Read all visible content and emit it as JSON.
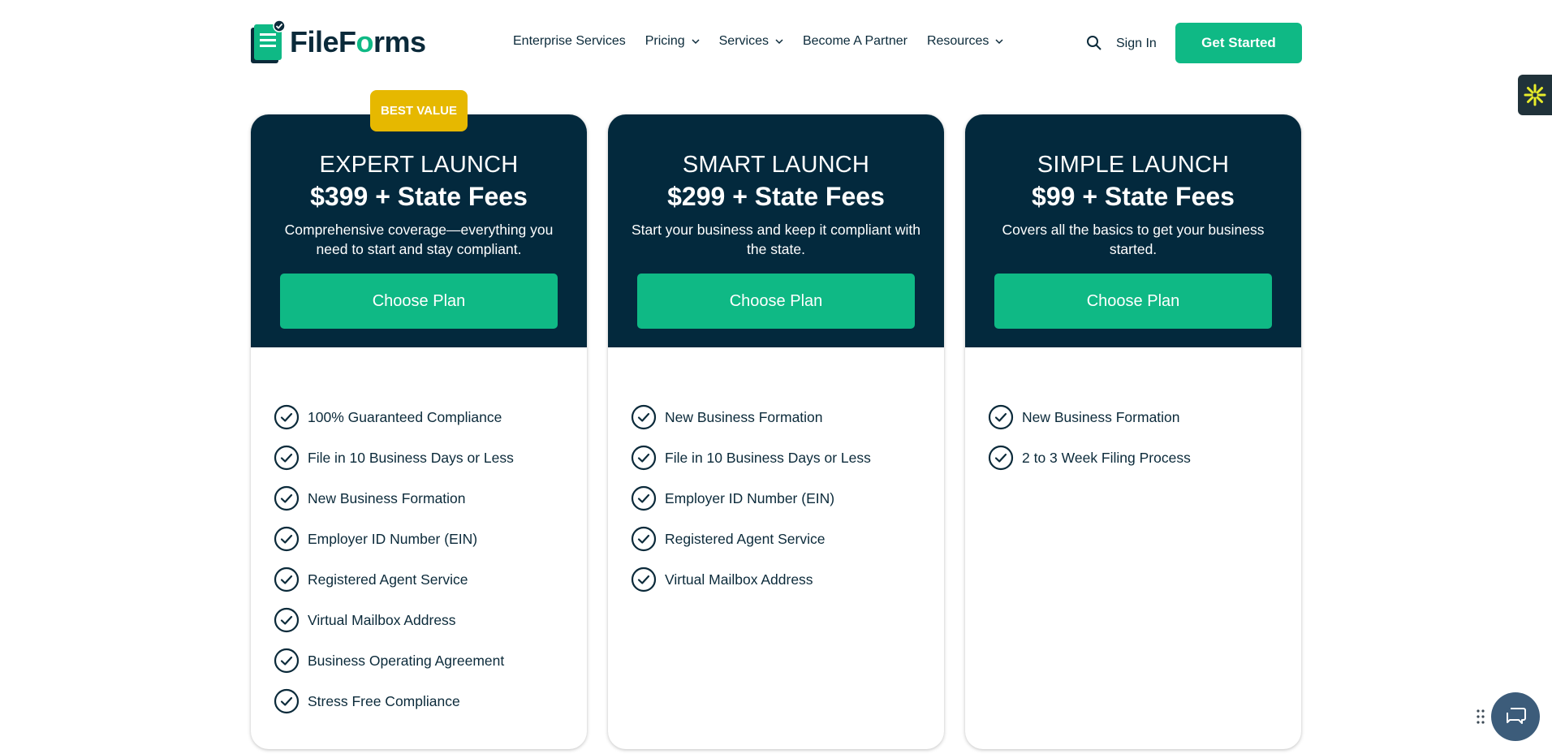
{
  "header": {
    "logo_text_a": "FileF",
    "logo_text_o": "o",
    "logo_text_b": "rms",
    "nav": [
      {
        "label": "Enterprise Services",
        "dropdown": false
      },
      {
        "label": "Pricing",
        "dropdown": true
      },
      {
        "label": "Services",
        "dropdown": true
      },
      {
        "label": "Become A Partner",
        "dropdown": false
      },
      {
        "label": "Resources",
        "dropdown": true
      }
    ],
    "sign_in": "Sign In",
    "get_started": "Get Started"
  },
  "badge": "BEST VALUE",
  "plans": [
    {
      "name": "EXPERT LAUNCH",
      "price": "$399 + State Fees",
      "description": "Comprehensive coverage—everything you need to start and stay compliant.",
      "cta": "Choose Plan",
      "features": [
        "100% Guaranteed Compliance",
        "File in 10 Business Days or Less",
        "New Business Formation",
        "Employer ID Number (EIN)",
        "Registered Agent Service",
        "Virtual Mailbox Address",
        "Business Operating Agreement",
        "Stress Free Compliance"
      ]
    },
    {
      "name": "SMART LAUNCH",
      "price": "$299 + State Fees",
      "description": "Start your business and keep it compliant with the state.",
      "cta": "Choose Plan",
      "features": [
        "New Business Formation",
        "File in 10 Business Days or Less",
        "Employer ID Number (EIN)",
        "Registered Agent Service",
        "Virtual Mailbox Address"
      ]
    },
    {
      "name": "SIMPLE LAUNCH",
      "price": "$99 + State Fees",
      "description": "Covers all the basics to get your business started.",
      "cta": "Choose Plan",
      "features": [
        "New Business Formation",
        "2 to 3 Week Filing Process"
      ]
    }
  ],
  "colors": {
    "brand_green": "#0fb985",
    "navy": "#03293d",
    "badge_gold": "#e6b800"
  },
  "icons": {
    "feature": "check-circle-icon",
    "search": "search-icon",
    "chat": "chat-icon",
    "side_widget": "asterisk-icon"
  }
}
